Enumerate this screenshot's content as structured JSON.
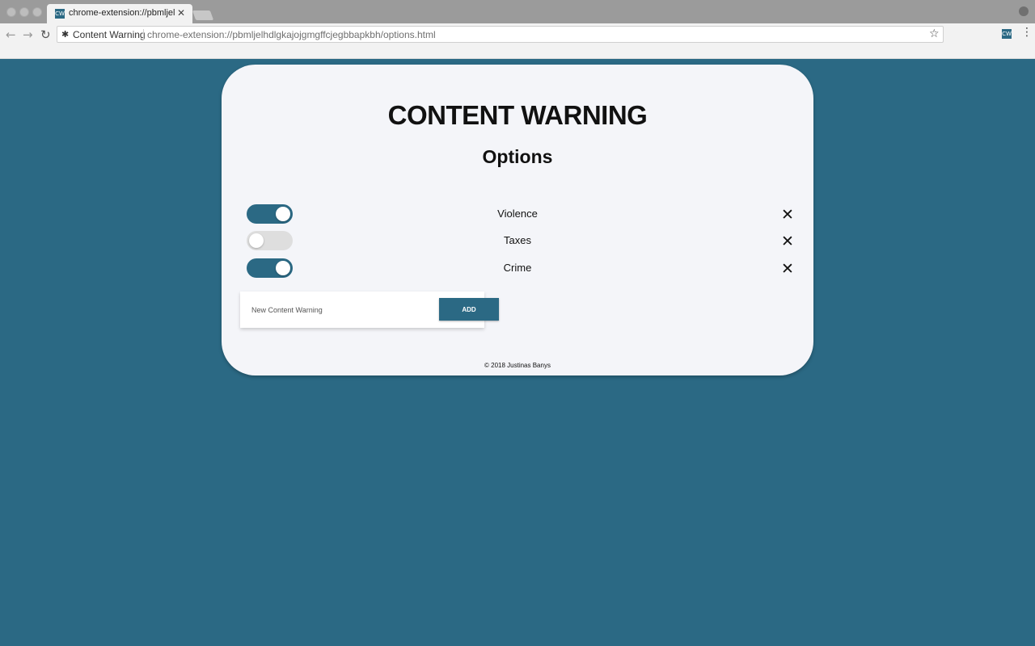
{
  "browser": {
    "tab_title": "chrome-extension://pbmljelhdlgkajojgmgffcjegbbapkbh",
    "tab_favicon_text": "CW",
    "site_label": "Content Warning",
    "url": "chrome-extension://pbmljelhdlgkajojgmgffcjegbbapkbh/options.html",
    "extension_icon_text": "CW"
  },
  "page": {
    "title": "CONTENT WARNING",
    "subtitle": "Options",
    "warnings": [
      {
        "label": "Violence",
        "enabled": true
      },
      {
        "label": "Taxes",
        "enabled": false
      },
      {
        "label": "Crime",
        "enabled": true
      }
    ],
    "new_warning": {
      "placeholder": "New Content Warning",
      "value": ""
    },
    "add_button_label": "ADD",
    "footer": "© 2018 Justinas Banys"
  },
  "colors": {
    "accent": "#2b6984",
    "card_background": "#f4f5f9",
    "toggle_off": "#dedede"
  },
  "icons": {
    "remove": "close-icon",
    "back": "back-arrow-icon",
    "forward": "forward-arrow-icon",
    "reload": "reload-icon",
    "bookmark": "star-icon",
    "menu": "menu-dots-icon"
  }
}
